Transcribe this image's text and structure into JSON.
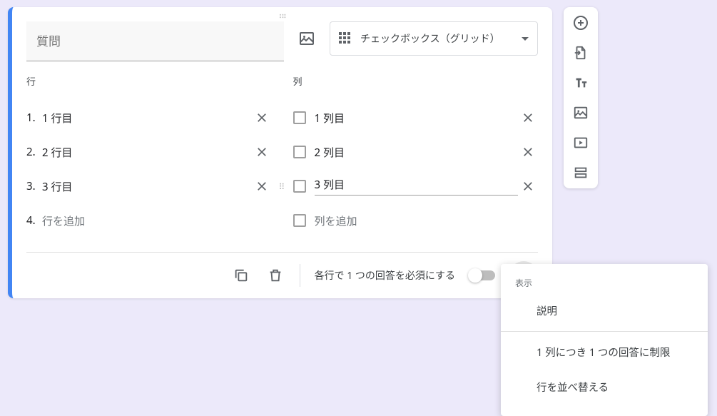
{
  "question": {
    "placeholder": "質問"
  },
  "typeSelect": {
    "label": "チェックボックス（グリッド）"
  },
  "rows": {
    "header": "行",
    "items": [
      {
        "num": "1.",
        "label": "1 行目"
      },
      {
        "num": "2.",
        "label": "2 行目"
      },
      {
        "num": "3.",
        "label": "3 行目"
      }
    ],
    "addNum": "4.",
    "addLabel": "行を追加"
  },
  "cols": {
    "header": "列",
    "items": [
      {
        "label": "1 列目"
      },
      {
        "label": "2 列目"
      },
      {
        "label": "3 列目",
        "focused": true
      }
    ],
    "addLabel": "列を追加"
  },
  "footer": {
    "requiredLabel": "各行で 1 つの回答を必須にする"
  },
  "menu": {
    "header": "表示",
    "item1": "説明",
    "item2": "1 列につき 1 つの回答に制限",
    "item3": "行を並べ替える"
  }
}
